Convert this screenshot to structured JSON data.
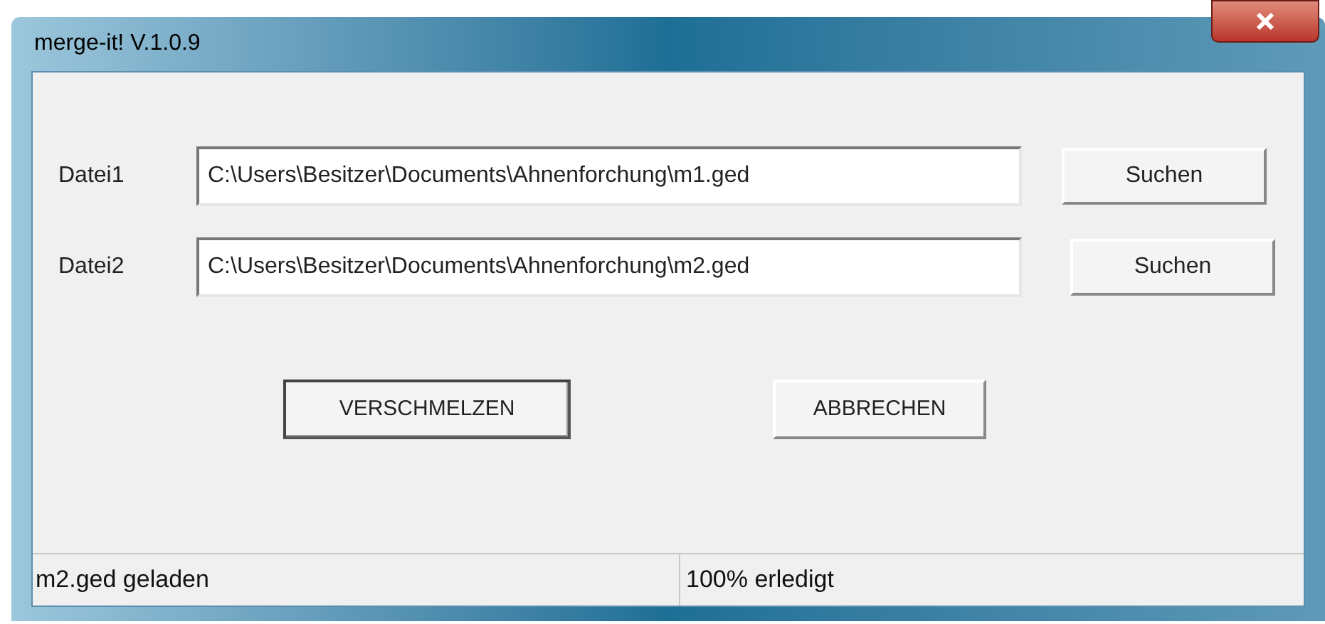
{
  "window": {
    "title": "merge-it!  V.1.0.9"
  },
  "files": [
    {
      "label": "Datei1",
      "value": "C:\\Users\\Besitzer\\Documents\\Ahnenforchung\\m1.ged",
      "button": "Suchen"
    },
    {
      "label": "Datei2",
      "value": "C:\\Users\\Besitzer\\Documents\\Ahnenforchung\\m2.ged",
      "button": "Suchen"
    }
  ],
  "actions": [
    {
      "label": "VERSCHMELZEN",
      "default": true
    },
    {
      "label": "ABBRECHEN",
      "default": false
    }
  ],
  "status_bar": [
    "m2.ged geladen",
    "100% erledigt"
  ]
}
